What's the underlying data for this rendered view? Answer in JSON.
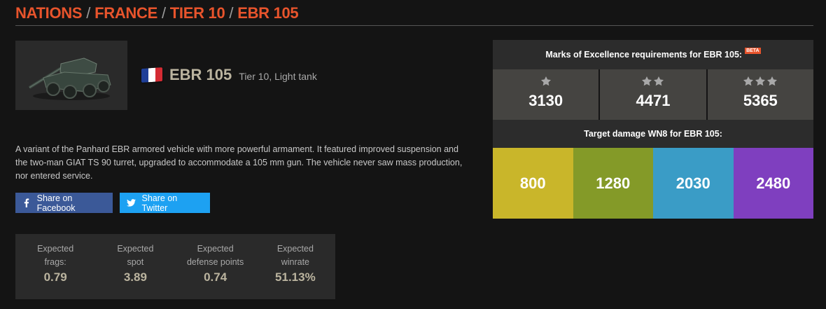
{
  "breadcrumb": {
    "items": [
      "NATIONS",
      "FRANCE",
      "TIER 10",
      "EBR 105"
    ],
    "separator": "/"
  },
  "vehicle": {
    "name": "EBR 105",
    "subtitle": "Tier 10, Light tank",
    "flag_colors": [
      "#1f3f97",
      "#ffffff",
      "#d42b33"
    ],
    "thumbnail_icon": "tank-image"
  },
  "description": "A variant of the Panhard EBR armored vehicle with more powerful armament. It featured improved suspension and the two-man GIAT TS 90 turret, upgraded to accommodate a 105 mm gun. The vehicle never saw mass production, nor entered service.",
  "share": {
    "facebook_label": "Share on Facebook",
    "facebook_icon": "facebook-icon",
    "facebook_color": "#3b5998",
    "twitter_label": "Share on Twitter",
    "twitter_icon": "twitter-icon",
    "twitter_color": "#1da1f2"
  },
  "expected": [
    {
      "label_line1": "Expected",
      "label_line2": "frags:",
      "value": "0.79"
    },
    {
      "label_line1": "Expected",
      "label_line2": "spot",
      "value": "3.89"
    },
    {
      "label_line1": "Expected",
      "label_line2": "defense points",
      "value": "0.74"
    },
    {
      "label_line1": "Expected",
      "label_line2": "winrate",
      "value": "51.13%"
    }
  ],
  "moe": {
    "title": "Marks of Excellence requirements for EBR 105:",
    "beta_label": "BETA",
    "marks": [
      {
        "stars": 1,
        "value": "3130"
      },
      {
        "stars": 2,
        "value": "4471"
      },
      {
        "stars": 3,
        "value": "5365"
      }
    ]
  },
  "wn8": {
    "title": "Target damage WN8 for EBR 105:",
    "tiers": [
      {
        "value": "800",
        "color": "#c9b62a"
      },
      {
        "value": "1280",
        "color": "#849a28"
      },
      {
        "value": "2030",
        "color": "#3a9cc6"
      },
      {
        "value": "2480",
        "color": "#7f3fbf"
      }
    ]
  },
  "colors": {
    "accent": "#e8542c",
    "background": "#141414",
    "panel": "#2a2a2a",
    "muted_gold": "#bbb49f"
  }
}
